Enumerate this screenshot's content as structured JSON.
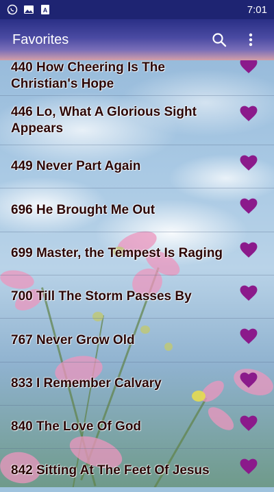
{
  "status_bar": {
    "time": "7:01",
    "icons": [
      "whatsapp-icon",
      "gallery-icon",
      "news-icon"
    ]
  },
  "app_bar": {
    "title": "Favorites",
    "search_icon": "search-icon",
    "menu_icon": "more-vert-icon"
  },
  "colors": {
    "status_bar": "#1e2472",
    "heart": "#8b1a8b",
    "text": "#2b0606"
  },
  "favorites": [
    {
      "label": "440 How Cheering Is The Christian's Hope"
    },
    {
      "label": "446 Lo, What A Glorious Sight Appears"
    },
    {
      "label": "449 Never Part Again"
    },
    {
      "label": "696 He Brought Me Out"
    },
    {
      "label": "699 Master, the Tempest Is Raging"
    },
    {
      "label": "700 Till The Storm Passes By"
    },
    {
      "label": "767 Never Grow Old"
    },
    {
      "label": "833 I Remember Calvary"
    },
    {
      "label": "840 The Love Of God"
    },
    {
      "label": "842 Sitting At The Feet Of Jesus"
    }
  ]
}
